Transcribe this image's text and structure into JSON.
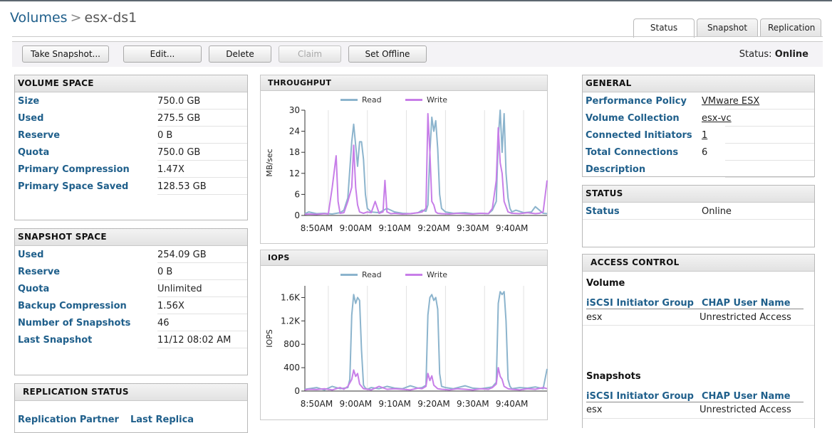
{
  "breadcrumb": {
    "root": "Volumes",
    "separator": ">",
    "current": "esx-ds1"
  },
  "tabs": [
    {
      "label": "Status",
      "active": true
    },
    {
      "label": "Snapshot",
      "active": false
    },
    {
      "label": "Replication",
      "active": false
    }
  ],
  "toolbar": {
    "take_snapshot": "Take Snapshot...",
    "edit": "Edit...",
    "delete": "Delete",
    "claim": "Claim",
    "set_offline": "Set Offline",
    "status_label": "Status:",
    "status_value": "Online"
  },
  "volume_space": {
    "title": "VOLUME SPACE",
    "rows": [
      {
        "label": "Size",
        "value": "750.0 GB"
      },
      {
        "label": "Used",
        "value": "275.5 GB"
      },
      {
        "label": "Reserve",
        "value": "0 B"
      },
      {
        "label": "Quota",
        "value": "750.0 GB"
      },
      {
        "label": "Primary Compression",
        "value": "1.47X"
      },
      {
        "label": "Primary Space Saved",
        "value": "128.53 GB"
      }
    ]
  },
  "snapshot_space": {
    "title": "SNAPSHOT SPACE",
    "rows": [
      {
        "label": "Used",
        "value": "254.09 GB"
      },
      {
        "label": "Reserve",
        "value": "0 B"
      },
      {
        "label": "Quota",
        "value": "Unlimited"
      },
      {
        "label": "Backup Compression",
        "value": "1.56X"
      },
      {
        "label": "Number of Snapshots",
        "value": "46"
      },
      {
        "label": "Last Snapshot",
        "value": "11/12 08:02 AM"
      }
    ]
  },
  "replication_status": {
    "title": "REPLICATION STATUS",
    "col1": "Replication Partner",
    "col2": "Last Replica"
  },
  "general": {
    "title": "GENERAL",
    "rows": [
      {
        "label": "Performance Policy",
        "value": "VMware ESX",
        "link": true
      },
      {
        "label": "Volume Collection",
        "value": "esx-vc",
        "link": true
      },
      {
        "label": "Connected Initiators",
        "value": "1",
        "link": true
      },
      {
        "label": "Total Connections",
        "value": "6",
        "link": false
      },
      {
        "label": "Description",
        "value": "",
        "link": false
      }
    ]
  },
  "status_panel": {
    "title": "STATUS",
    "label": "Status",
    "value": "Online"
  },
  "access_control": {
    "title": "ACCESS CONTROL",
    "volume": {
      "title": "Volume",
      "col1": "iSCSI Initiator Group",
      "col2": "CHAP User Name",
      "group": "esx",
      "chap": "Unrestricted Access"
    },
    "snapshots": {
      "title": "Snapshots",
      "col1": "iSCSI Initiator Group",
      "col2": "CHAP User Name",
      "group": "esx",
      "chap": "Unrestricted Access"
    }
  },
  "colors": {
    "read": "#8cb4cd",
    "write": "#c77ee8",
    "label_blue": "#1f5f8b"
  },
  "chart_data": [
    {
      "type": "line",
      "title": "THROUGHPUT",
      "ylabel": "MB/sec",
      "ylim": [
        0,
        30
      ],
      "yticks": [
        "0",
        "6",
        "12",
        "18",
        "24",
        "30"
      ],
      "ytick_values": [
        0,
        6,
        12,
        18,
        24,
        30
      ],
      "x_ticks": [
        "8:50AM",
        "9:00AM",
        "9:10AM",
        "9:20AM",
        "9:30AM",
        "9:40AM"
      ],
      "x_tick_minutes": [
        0,
        10,
        20,
        30,
        40,
        50
      ],
      "x_range_minutes": [
        -3,
        59
      ],
      "grid": "vertical",
      "legend": "top",
      "series": [
        {
          "name": "Read",
          "color": "#8cb4cd",
          "x": [
            -3,
            -2,
            0,
            2,
            4,
            6,
            7,
            8,
            9,
            9.5,
            10,
            10.5,
            11,
            11.5,
            12,
            12.5,
            13,
            14,
            16,
            18,
            20,
            22,
            24,
            26,
            27,
            28,
            28.5,
            29,
            29.5,
            30,
            30.5,
            31,
            31.5,
            32,
            33,
            35,
            38,
            40,
            42,
            44,
            45,
            46,
            46.5,
            47,
            47.5,
            48,
            48.5,
            49,
            49.5,
            50,
            51,
            53,
            55,
            56,
            58,
            59
          ],
          "y": [
            0.5,
            1,
            0.5,
            0.6,
            0.4,
            0.8,
            1.5,
            5,
            21,
            26,
            20,
            14,
            21,
            21,
            16,
            6,
            2,
            1,
            0.8,
            2,
            1,
            0.6,
            0.5,
            0.8,
            1.5,
            1.2,
            3,
            18,
            28,
            24,
            27,
            19,
            6,
            2,
            1,
            0.6,
            0.8,
            0.5,
            0.6,
            0.5,
            1.5,
            4,
            22,
            30,
            18,
            29,
            12,
            5,
            2,
            1,
            1.5,
            0.8,
            1,
            2.5,
            0.6,
            0.5
          ]
        },
        {
          "name": "Write",
          "color": "#c77ee8",
          "x": [
            -3,
            -2,
            0,
            2,
            3,
            4,
            5,
            5.5,
            6,
            7,
            8,
            9,
            9.5,
            10,
            10.5,
            11,
            12,
            13,
            14,
            15,
            16,
            17,
            17.5,
            18,
            19,
            20,
            22,
            24,
            26,
            27,
            28,
            28.5,
            29,
            29.5,
            30,
            30.5,
            31,
            32,
            34,
            36,
            38,
            40,
            42,
            44,
            45,
            46,
            46.5,
            47,
            47.5,
            48,
            49,
            50,
            52,
            54,
            56,
            57,
            58,
            59
          ],
          "y": [
            0.3,
            0.4,
            0.3,
            0.5,
            0.4,
            8,
            17,
            4,
            0.6,
            0.8,
            4,
            8,
            20,
            8,
            3,
            1,
            0.6,
            1,
            0.8,
            4,
            0.6,
            1,
            10,
            1,
            0.5,
            0.6,
            0.4,
            0.5,
            0.8,
            1,
            2,
            29,
            18,
            4,
            3,
            1,
            0.6,
            0.5,
            0.4,
            0.6,
            0.5,
            0.4,
            0.6,
            0.5,
            2,
            10,
            25,
            15,
            12,
            4,
            1,
            0.6,
            0.5,
            0.8,
            0.5,
            0.6,
            1,
            10
          ]
        }
      ]
    },
    {
      "type": "line",
      "title": "IOPS",
      "ylabel": "IOPS",
      "ylim": [
        0,
        1800
      ],
      "yticks": [
        "0",
        "400",
        "800",
        "1.2K",
        "1.6K"
      ],
      "ytick_values": [
        0,
        400,
        800,
        1200,
        1600
      ],
      "x_ticks": [
        "8:50AM",
        "9:00AM",
        "9:10AM",
        "9:20AM",
        "9:30AM",
        "9:40AM"
      ],
      "x_tick_minutes": [
        0,
        10,
        20,
        30,
        40,
        50
      ],
      "x_range_minutes": [
        -3,
        59
      ],
      "grid": "vertical",
      "legend": "top",
      "series": [
        {
          "name": "Read",
          "color": "#8cb4cd",
          "x": [
            -3,
            -2,
            0,
            2,
            4,
            6,
            8,
            8.5,
            9,
            9.5,
            10,
            10.5,
            11,
            11.5,
            12,
            12.5,
            13,
            14,
            16,
            18,
            20,
            22,
            24,
            26,
            27,
            28,
            28.5,
            29,
            29.5,
            30,
            30.5,
            31,
            31.5,
            32,
            33,
            35,
            38,
            40,
            42,
            44,
            45,
            46,
            46.5,
            47,
            47.5,
            48,
            48.5,
            49,
            49.5,
            50,
            52,
            54,
            56,
            58,
            59
          ],
          "y": [
            30,
            40,
            60,
            20,
            80,
            40,
            60,
            200,
            1300,
            1650,
            1500,
            1600,
            1550,
            700,
            100,
            50,
            30,
            60,
            40,
            80,
            50,
            40,
            90,
            50,
            60,
            100,
            1300,
            1600,
            1650,
            1550,
            1600,
            1400,
            300,
            80,
            60,
            40,
            90,
            50,
            40,
            60,
            70,
            150,
            1500,
            1700,
            1650,
            1700,
            1200,
            200,
            80,
            40,
            60,
            50,
            70,
            40,
            380
          ]
        },
        {
          "name": "Write",
          "color": "#c77ee8",
          "x": [
            -3,
            -2,
            0,
            2,
            4,
            6,
            7,
            8,
            9,
            9.5,
            10,
            10.5,
            11,
            12,
            13,
            14,
            16,
            18,
            20,
            22,
            24,
            26,
            27,
            28,
            28.5,
            29,
            29.5,
            30,
            31,
            32,
            34,
            36,
            38,
            40,
            42,
            44,
            45,
            46,
            46.5,
            47,
            47.5,
            48,
            49,
            50,
            52,
            54,
            56,
            58,
            59
          ],
          "y": [
            20,
            30,
            25,
            40,
            20,
            60,
            30,
            80,
            200,
            360,
            250,
            300,
            120,
            40,
            30,
            20,
            80,
            30,
            40,
            30,
            20,
            50,
            40,
            80,
            300,
            180,
            260,
            100,
            40,
            30,
            20,
            40,
            30,
            20,
            40,
            30,
            60,
            120,
            400,
            250,
            200,
            80,
            40,
            30,
            20,
            40,
            30,
            60,
            40
          ]
        }
      ]
    }
  ]
}
